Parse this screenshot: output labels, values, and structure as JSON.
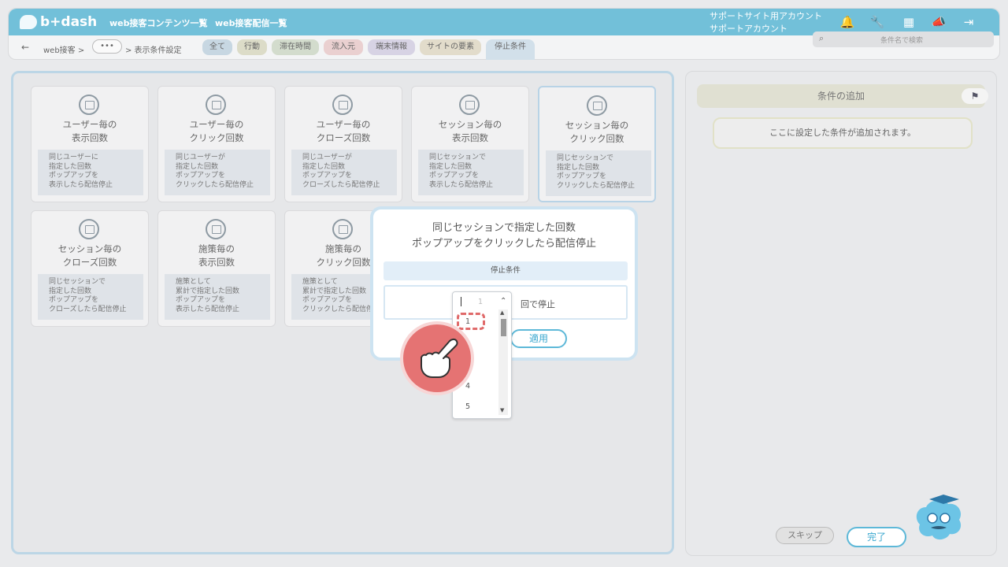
{
  "header": {
    "logo_text": "b+dash",
    "nav": [
      "web接客コンテンツ一覧",
      "web接客配信一覧"
    ],
    "account_line1": "サポートサイト用アカウント",
    "account_line2": "サポートアカウント",
    "icons": [
      "bell-icon",
      "wrench-icon",
      "grid-icon",
      "megaphone-icon",
      "logout-icon"
    ]
  },
  "breadcrumb": {
    "back": "←",
    "root": "web接客 >",
    "more": "•••",
    "current": "> 表示条件設定"
  },
  "filters": [
    {
      "label": "全て",
      "color": "#c7d7e2"
    },
    {
      "label": "行動",
      "color": "#dcdcc8"
    },
    {
      "label": "滞在時間",
      "color": "#d3dccd"
    },
    {
      "label": "流入元",
      "color": "#ead0d0"
    },
    {
      "label": "端末情報",
      "color": "#d7d3e4"
    },
    {
      "label": "サイトの要素",
      "color": "#e2dccb"
    },
    {
      "label": "停止条件",
      "color": "#d2e0ea"
    }
  ],
  "search": {
    "placeholder": "条件名で検索"
  },
  "cards": [
    {
      "title1": "ユーザー毎の",
      "title2": "表示回数",
      "desc": [
        "同じユーザーに",
        "指定した回数",
        "ポップアップを",
        "表示したら配信停止"
      ]
    },
    {
      "title1": "ユーザー毎の",
      "title2": "クリック回数",
      "desc": [
        "同じユーザーが",
        "指定した回数",
        "ポップアップを",
        "クリックしたら配信停止"
      ]
    },
    {
      "title1": "ユーザー毎の",
      "title2": "クローズ回数",
      "desc": [
        "同じユーザーが",
        "指定した回数",
        "ポップアップを",
        "クローズしたら配信停止"
      ]
    },
    {
      "title1": "セッション毎の",
      "title2": "表示回数",
      "desc": [
        "同じセッションで",
        "指定した回数",
        "ポップアップを",
        "表示したら配信停止"
      ]
    },
    {
      "title1": "セッション毎の",
      "title2": "クリック回数",
      "desc": [
        "同じセッションで",
        "指定した回数",
        "ポップアップを",
        "クリックしたら配信停止"
      ]
    },
    {
      "title1": "セッション毎の",
      "title2": "クローズ回数",
      "desc": [
        "同じセッションで",
        "指定した回数",
        "ポップアップを",
        "クローズしたら配信停止"
      ]
    },
    {
      "title1": "施策毎の",
      "title2": "表示回数",
      "desc": [
        "施策として",
        "累計で指定した回数",
        "ポップアップを",
        "表示したら配信停止"
      ]
    },
    {
      "title1": "施策毎の",
      "title2": "クリック回数",
      "desc": [
        "施策として",
        "累計で指定した回数",
        "ポップアップを",
        "クリックしたら配信停止"
      ]
    }
  ],
  "right_panel": {
    "add_title": "条件の追加",
    "add_icon": "beginner-mark-icon",
    "placeholder": "ここに設定した条件が追加されます。",
    "skip": "スキップ",
    "done": "完了"
  },
  "modal": {
    "title_line1": "同じセッションで指定した回数",
    "title_line2": "ポップアップをクリックしたら配信停止",
    "section_header": "停止条件",
    "input_placeholder": "1",
    "suffix": "回で停止",
    "apply": "適用",
    "options": [
      "1",
      "4",
      "5"
    ]
  }
}
